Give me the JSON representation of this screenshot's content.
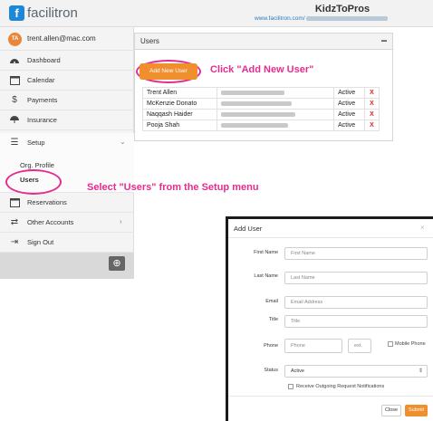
{
  "topbar": {
    "logo_letter": "f",
    "logo_text": "facilitron",
    "org_name": "KidzToPros",
    "org_url_prefix": "www.facilitron.com/"
  },
  "sidebar": {
    "avatar_initials": "TA",
    "user_email": "trent.allen@mac.com",
    "items": {
      "dashboard": "Dashboard",
      "calendar": "Calendar",
      "payments": "Payments",
      "insurance": "Insurance",
      "setup": "Setup",
      "org_profile": "Org. Profile",
      "users": "Users",
      "reservations": "Reservations",
      "other_accounts": "Other Accounts",
      "sign_out": "Sign Out"
    },
    "icons": {
      "dashboard": "dashboard-icon",
      "calendar": "calendar-icon",
      "payments": "dollar-icon",
      "insurance": "umbrella-icon",
      "setup": "list-icon",
      "reservations": "calendar-icon",
      "other_accounts": "exchange-icon",
      "sign_out": "sign-out-icon"
    }
  },
  "panel": {
    "title": "Users",
    "collapse_symbol": "−",
    "add_button": "Add New User",
    "rows": [
      {
        "name": "Trent Allen",
        "status": "Active",
        "delete": "X"
      },
      {
        "name": "McKenzie Donato",
        "status": "Active",
        "delete": "X"
      },
      {
        "name": "Naqqash Haider",
        "status": "Active",
        "delete": "X"
      },
      {
        "name": "Pooja Shah",
        "status": "Active",
        "delete": "X"
      }
    ]
  },
  "annotations": {
    "add_user": "Click \"Add New User\"",
    "select_users": "Select \"Users\" from the Setup menu"
  },
  "modal": {
    "title": "Add User",
    "close_x": "×",
    "first_name_label": "First Name",
    "first_name_placeholder": "First Name",
    "last_name_label": "Last Name",
    "last_name_placeholder": "Last Name",
    "email_label": "Email",
    "email_placeholder": "Email Address",
    "title_label": "Title",
    "title_placeholder": "Title",
    "phone_label": "Phone",
    "phone_placeholder": "Phone",
    "ext_placeholder": "ext.",
    "mobile_phone_label": "Mobile Phone",
    "status_label": "Status",
    "status_value": "Active",
    "notifications_label": "Receive Outgoing Request Notifications",
    "close_button": "Close",
    "submit_button": "Submit"
  },
  "colors": {
    "accent_orange": "#ef8f2e",
    "highlight_pink": "#e52d8f",
    "delete_red": "#e02020",
    "brand_blue": "#1e88d8"
  }
}
